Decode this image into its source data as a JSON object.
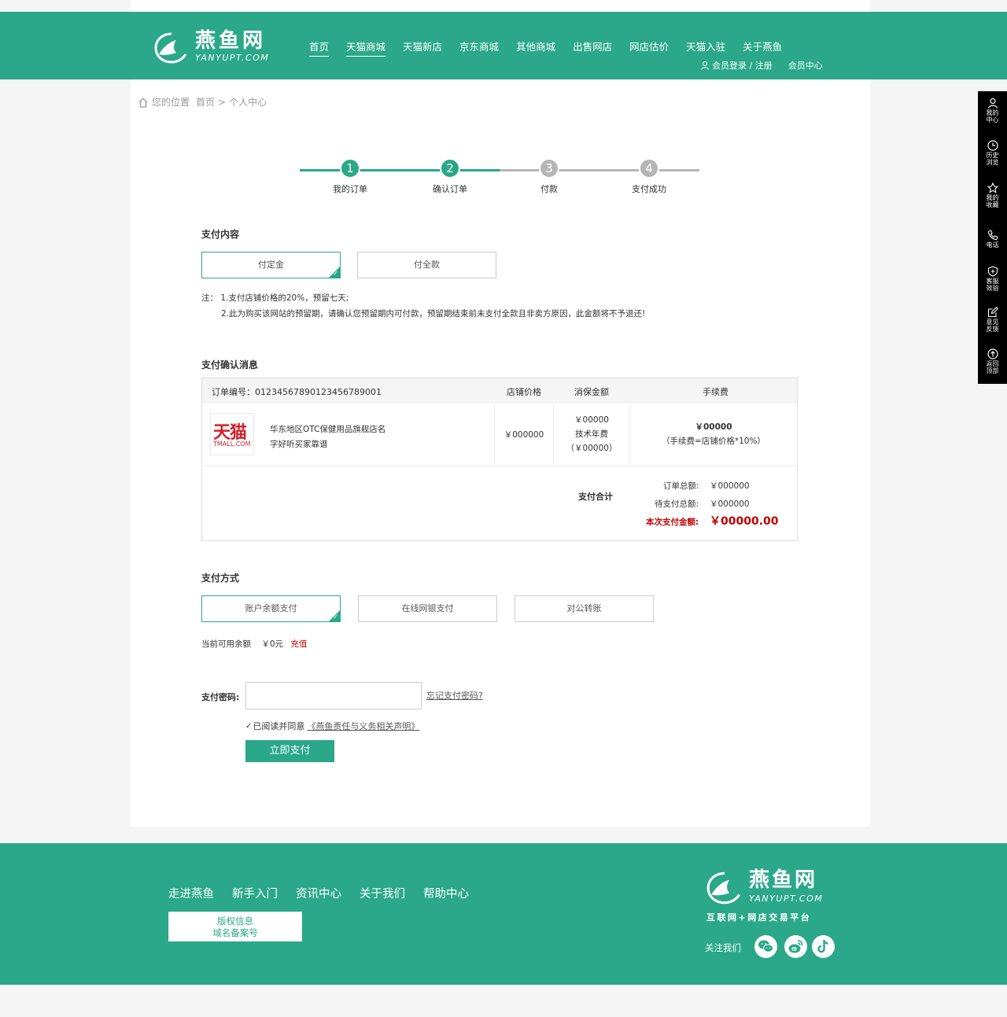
{
  "header": {
    "logo_cn": "燕鱼网",
    "logo_en": "YANYUPT.COM",
    "nav": [
      "首页",
      "天猫商城",
      "天猫新店",
      "京东商城",
      "其他商城",
      "出售网店",
      "网店估价",
      "天猫入驻",
      "关于燕鱼"
    ],
    "login_register": "会员登录 / 注册",
    "member_center": "会员中心"
  },
  "breadcrumb": {
    "label": "您的位置",
    "home": "首页",
    "separator": ">",
    "current": "个人中心"
  },
  "steps": [
    {
      "num": "1",
      "label": "我的订单",
      "done": true
    },
    {
      "num": "2",
      "label": "确认订单",
      "done": true
    },
    {
      "num": "3",
      "label": "付款",
      "done": false
    },
    {
      "num": "4",
      "label": "支付成功",
      "done": false
    }
  ],
  "pay_content": {
    "title": "支付内容",
    "options": [
      "付定金",
      "付全款"
    ],
    "selected": 0,
    "note_1": "注： 1.支付店铺价格的20%，预留七天;",
    "note_2": "2.此为购买该网站的预留期，请确认您预留期内可付款，预留期结束前未支付全款且非卖方原因，此金额将不予退还!"
  },
  "confirm": {
    "title": "支付确认消息",
    "order_no": "订单编号：01234567890123456789001",
    "col_price": "店铺价格",
    "col_deposit": "消保金额",
    "col_fee": "手续费",
    "shop_logo_text": "天猫",
    "shop_logo_sub": "TMALL.COM",
    "shop_name": "华东地区OTC保健用品旗舰店名",
    "shop_desc": "字好听买家靠谱",
    "price": "￥000000",
    "deposit_1": "￥00000",
    "deposit_2": "技术年费",
    "deposit_3": "（￥00000）",
    "fee": "￥00000",
    "fee_note": "（手续费=店铺价格*10%）",
    "total_label": "支付合计",
    "order_total_label": "订单总额:",
    "order_total": "￥000000",
    "pending_label": "待支付总额:",
    "pending": "￥000000",
    "this_pay_label": "本次支付金额:",
    "this_pay": "￥00000.00"
  },
  "pay_method": {
    "title": "支付方式",
    "options": [
      "账户余额支付",
      "在线网银支付",
      "对公转账"
    ],
    "selected": 0,
    "balance_label": "当前可用余额",
    "balance": "￥0元",
    "recharge": "充值"
  },
  "password": {
    "label": "支付密码:",
    "value": "",
    "forgot": "忘记支付密码?",
    "agree_text": "已阅读并同意",
    "agree_link": "《燕鱼责任与义务相关声明》",
    "pay_button": "立即支付"
  },
  "sidebar": [
    {
      "icon": "user-icon",
      "label_1": "我的",
      "label_2": "中心"
    },
    {
      "icon": "clock-icon",
      "label_1": "历史",
      "label_2": "浏览"
    },
    {
      "icon": "star-icon",
      "label_1": "我的",
      "label_2": "收藏"
    },
    {
      "icon": "phone-icon",
      "label_1": "电话",
      "label_2": ""
    },
    {
      "icon": "shield-icon",
      "label_1": "客服",
      "label_2": "效验"
    },
    {
      "icon": "edit-icon",
      "label_1": "意见",
      "label_2": "反馈"
    },
    {
      "icon": "arrow-up-icon",
      "label_1": "返回",
      "label_2": "顶部"
    }
  ],
  "footer": {
    "links": [
      "走进燕鱼",
      "新手入门",
      "资讯中心",
      "关于我们",
      "帮助中心"
    ],
    "box_1": "版权信息",
    "box_2": "域名备案号",
    "logo_cn": "燕鱼网",
    "logo_en": "YANYUPT.COM",
    "slogan": "互联网+网店交易平台",
    "follow": "关注我们"
  },
  "colors": {
    "brand": "#2aa889",
    "alert": "#c00000",
    "step_pending": "#b5b5b5"
  }
}
